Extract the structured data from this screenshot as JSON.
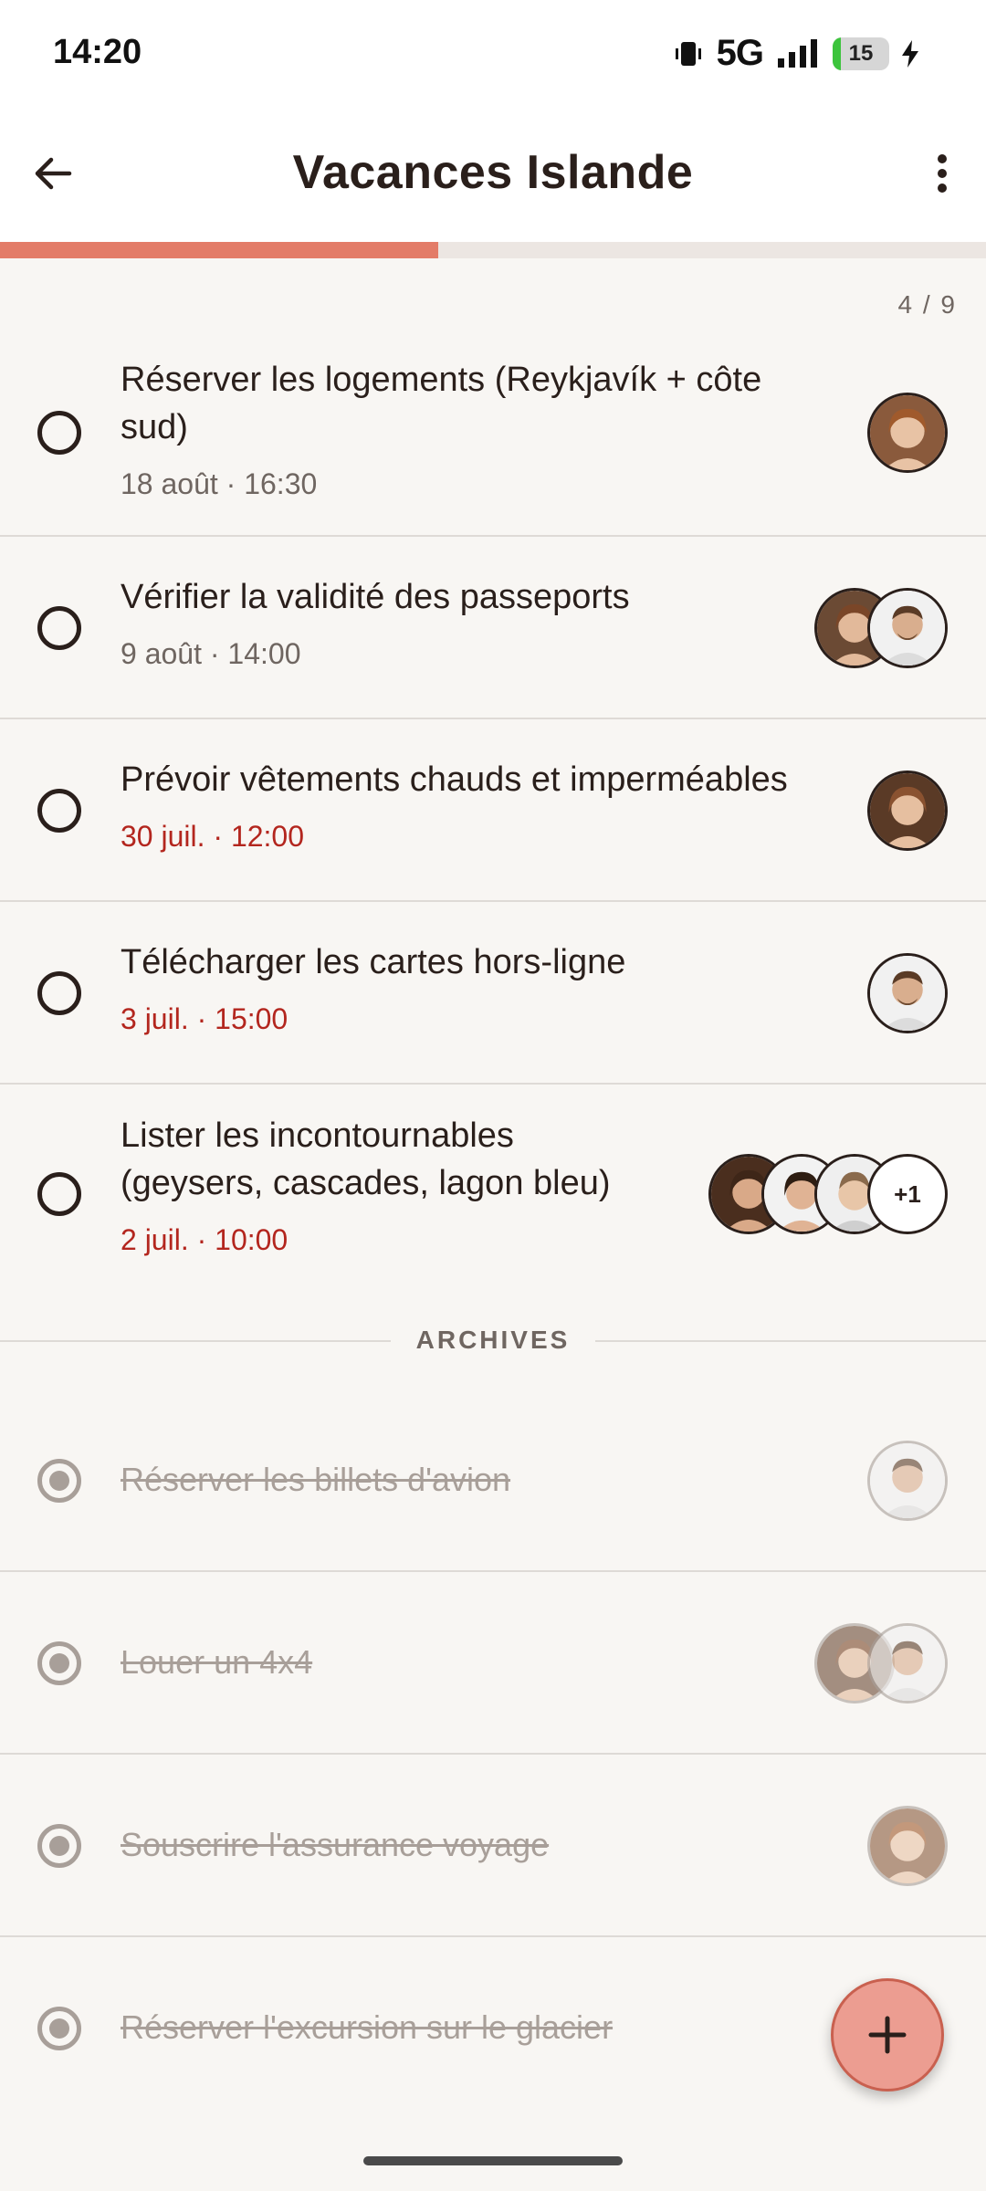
{
  "status": {
    "time": "14:20",
    "network": "5G",
    "battery": "15"
  },
  "header": {
    "title": "Vacances Islande"
  },
  "progress": {
    "count_text": "4 / 9",
    "fraction": 0.444
  },
  "tasks": [
    {
      "title_line1": "Réserver les logements (Reykjavík + côte",
      "title_line2": "sud)",
      "date": "18 août · 16:30",
      "overdue": false
    },
    {
      "title": "Vérifier la validité des passeports",
      "date": "9 août · 14:00",
      "overdue": false
    },
    {
      "title": "Prévoir vêtements chauds et imperméables",
      "date": "30 juil. · 12:00",
      "overdue": true
    },
    {
      "title": "Télécharger les cartes hors-ligne",
      "date": "3 juil. · 15:00",
      "overdue": true
    },
    {
      "title_line1": "Lister les incontournables",
      "title_line2": "(geysers, cascades, lagon bleu)",
      "date": "2 juil. · 10:00",
      "overdue": true,
      "more_label": "+1"
    }
  ],
  "archives": {
    "label": "ARCHIVES",
    "items": [
      {
        "title": "Réserver les billets d'avion"
      },
      {
        "title": "Louer un 4x4"
      },
      {
        "title": "Souscrire l'assurance voyage"
      },
      {
        "title": "Réserver l'excursion sur le glacier"
      }
    ]
  },
  "colors": {
    "accent": "#e37c68",
    "overdue": "#b3261e",
    "fab": "#ec9d91"
  }
}
